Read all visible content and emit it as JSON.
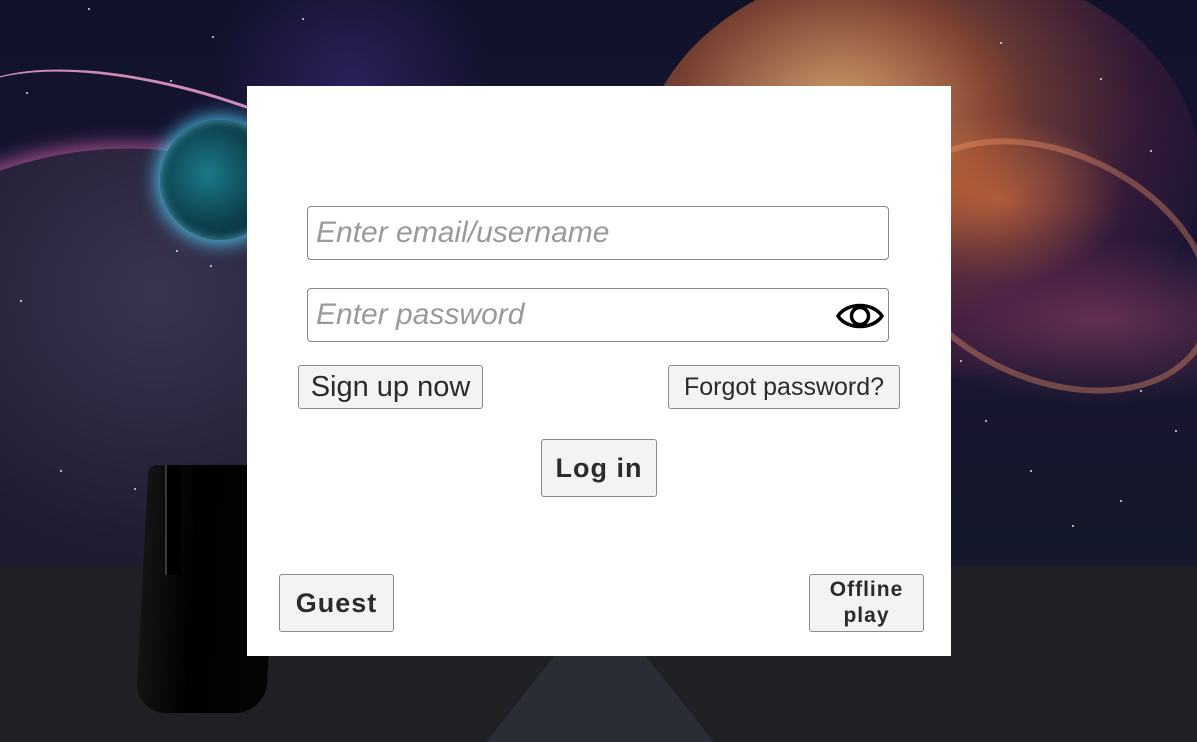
{
  "login_form": {
    "email_placeholder": "Enter email/username",
    "email_value": "",
    "password_placeholder": "Enter password",
    "password_value": "",
    "password_toggle_icon": "eye-icon",
    "signup_label": "Sign up now",
    "forgot_label": "Forgot password?",
    "login_label": "Log in",
    "guest_label": "Guest",
    "offline_label_line1": "Offline",
    "offline_label_line2": "play"
  },
  "colors": {
    "card_background": "#ffffff",
    "button_background": "#f3f3f3",
    "floor": "#1f2024"
  }
}
